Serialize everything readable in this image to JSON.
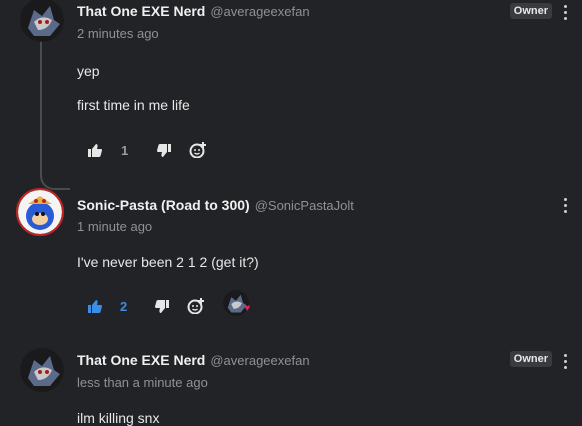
{
  "comments": [
    {
      "author": "That One EXE Nerd",
      "handle": "@averageexefan",
      "time": "2 minutes ago",
      "badge": "Owner",
      "lines": [
        "yep",
        "first time in me life"
      ],
      "likes": "1",
      "liked": false,
      "avatar_icon": "sonic-exe-avatar-icon"
    },
    {
      "author": "Sonic-Pasta (Road to 300)",
      "handle": "@SonicPastaJolt",
      "time": "1 minute ago",
      "lines": [
        "I've never been 2 1 2 (get it?)"
      ],
      "likes": "2",
      "liked": true,
      "avatar_icon": "sonic-pizza-avatar-icon",
      "reaction": "heart-icon"
    },
    {
      "author": "That One EXE Nerd",
      "handle": "@averageexefan",
      "time": "less than a minute ago",
      "badge": "Owner",
      "lines": [
        "ilm killing snx"
      ],
      "avatar_icon": "sonic-exe-avatar-icon"
    }
  ],
  "colors": {
    "background": "#222326",
    "liked_blue": "#3a8ee6",
    "muted": "#8f9196",
    "heart": "#e0245e"
  }
}
